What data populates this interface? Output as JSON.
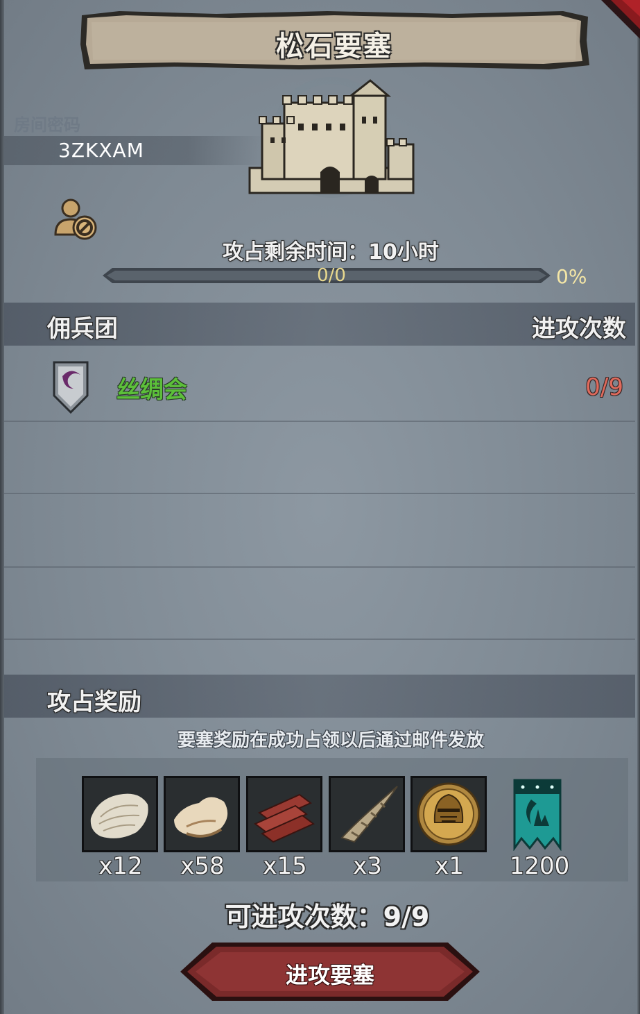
{
  "title": "松石要塞",
  "room": {
    "label": "房间密码",
    "code": "3ZKXAM"
  },
  "timer": {
    "label": "攻占剩余时间：10小时"
  },
  "progress": {
    "text": "0/0",
    "percent": "0%",
    "fill": 0
  },
  "mercenary": {
    "header_left": "佣兵团",
    "header_right": "进攻次数",
    "entries": [
      {
        "name": "丝绸会",
        "attacks": "0/9"
      }
    ]
  },
  "rewards": {
    "header": "攻占奖励",
    "note": "要塞奖励在成功占领以后通过邮件发放",
    "items": [
      {
        "icon": "fur-pelt-icon",
        "qty": "x12"
      },
      {
        "icon": "hide-pelt-icon",
        "qty": "x58"
      },
      {
        "icon": "wood-planks-icon",
        "qty": "x15"
      },
      {
        "icon": "horn-icon",
        "qty": "x3"
      },
      {
        "icon": "knight-helmet-medal-icon",
        "qty": "x1"
      },
      {
        "icon": "guild-banner-icon",
        "qty": "1200"
      }
    ]
  },
  "attacks_available": "可进攻次数：9/9",
  "attack_button": "进攻要塞",
  "colors": {
    "guild_name": "#5cbf3a",
    "attack_count": "#e06a5c",
    "button": "#7a2a2a"
  }
}
